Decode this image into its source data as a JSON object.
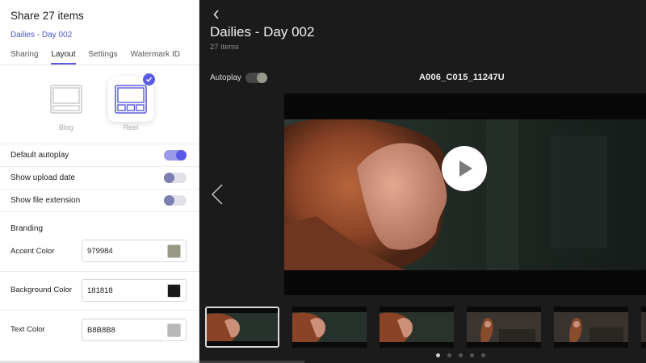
{
  "panel": {
    "title": "Share 27 items",
    "subtitle": "Dailies - Day 002",
    "tabs": [
      {
        "label": "Sharing"
      },
      {
        "label": "Layout"
      },
      {
        "label": "Settings"
      },
      {
        "label": "Watermark ID"
      }
    ],
    "active_tab": "Layout",
    "layout_options": [
      {
        "label": "Blog",
        "icon": "blog-layout-icon",
        "selected": false
      },
      {
        "label": "Reel",
        "icon": "reel-layout-icon",
        "selected": true
      }
    ],
    "toggles": [
      {
        "label": "Default autoplay",
        "on": true
      },
      {
        "label": "Show upload date",
        "on": false
      },
      {
        "label": "Show file extension",
        "on": false
      }
    ],
    "branding_heading": "Branding",
    "colors": [
      {
        "label": "Accent Color",
        "value": "979984",
        "swatch": "#979984"
      },
      {
        "label": "Background Color",
        "value": "181818",
        "swatch": "#181818"
      },
      {
        "label": "Text Color",
        "value": "B8B8B8",
        "swatch": "#B8B8B8"
      }
    ],
    "accent": "#5a5ae6"
  },
  "reel": {
    "title": "Dailies - Day 002",
    "count": "27 items",
    "autoplay_label": "Autoplay",
    "autoplay_on": true,
    "clip_name": "A006_C015_11247U",
    "icons": [
      "back-arrow-icon",
      "play-icon",
      "previous-arrow-icon"
    ],
    "thumbnails": [
      {
        "selected": true
      },
      {
        "selected": false
      },
      {
        "selected": false
      },
      {
        "selected": false
      },
      {
        "selected": false
      },
      {
        "selected": false
      }
    ],
    "pagination": {
      "pages": 5,
      "current": 1
    }
  }
}
